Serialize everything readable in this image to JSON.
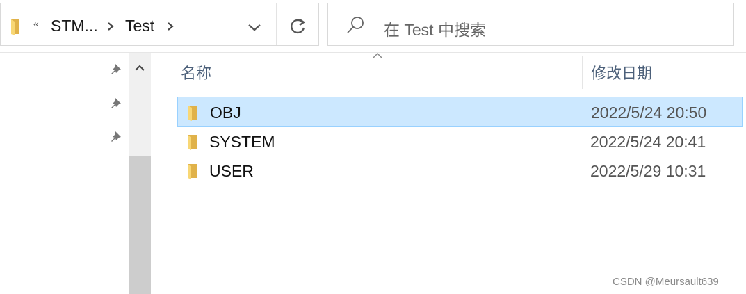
{
  "address_bar": {
    "overflow_label": "«",
    "breadcrumbs": [
      "STM...",
      "Test"
    ]
  },
  "search": {
    "placeholder": "在 Test 中搜索"
  },
  "columns": {
    "name": "名称",
    "date_modified": "修改日期"
  },
  "files": [
    {
      "name": "OBJ",
      "date": "2022/5/24 20:50",
      "selected": true
    },
    {
      "name": "SYSTEM",
      "date": "2022/5/24 20:41",
      "selected": false
    },
    {
      "name": "USER",
      "date": "2022/5/29 10:31",
      "selected": false
    }
  ],
  "icons": {
    "folder": "folder-icon",
    "pin": "pin-icon",
    "refresh": "refresh-icon",
    "search": "search-icon",
    "chevron": "chevron-right-icon",
    "dropdown": "chevron-down-icon"
  },
  "colors": {
    "selection_fill": "#cce8ff",
    "selection_border": "#99d1ff",
    "folder_yellow": "#f8d775"
  },
  "watermark": "CSDN @Meursault639"
}
